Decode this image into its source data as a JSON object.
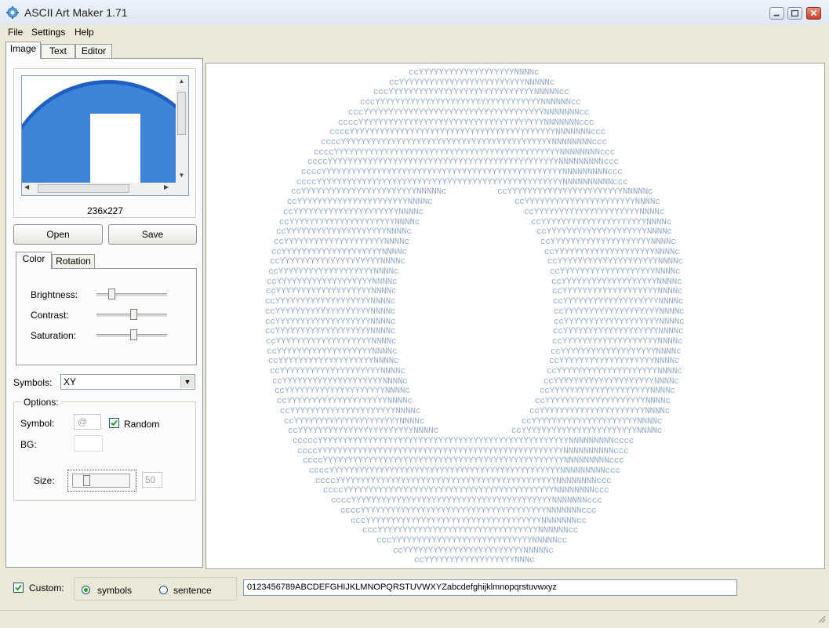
{
  "window": {
    "title": "ASCII Art Maker 1.71"
  },
  "menu": [
    "File",
    "Settings",
    "Help"
  ],
  "tabs": [
    "Image",
    "Text",
    "Editor"
  ],
  "image_panel": {
    "dimensions": "236x227",
    "open_label": "Open",
    "save_label": "Save"
  },
  "adjust_tabs": [
    "Color",
    "Rotation"
  ],
  "color": {
    "brightness_label": "Brightness:",
    "contrast_label": "Contrast:",
    "saturation_label": "Saturation:"
  },
  "symbols": {
    "label": "Symbols:",
    "value": "XY"
  },
  "options": {
    "title": "Options:",
    "symbol_label": "Symbol:",
    "symbol_value": "@",
    "random_label": "Random",
    "random_checked": true,
    "bg_label": "BG:",
    "size_label": "Size:",
    "size_value": "50"
  },
  "bottom": {
    "custom_label": "Custom:",
    "custom_checked": true,
    "symbols_option": "symbols",
    "sentence_option": "sentence",
    "selected_option": "symbols",
    "charset": "0123456789ABCDEFGHIJKLMNOPQRSTUVWXYZabcdefghijklmnopqrstuvwxyz"
  },
  "colors": {
    "accent_blue": "#3c7fd6",
    "ascii_light": "#c9d8ea",
    "ascii_dark": "#6f8db5"
  }
}
